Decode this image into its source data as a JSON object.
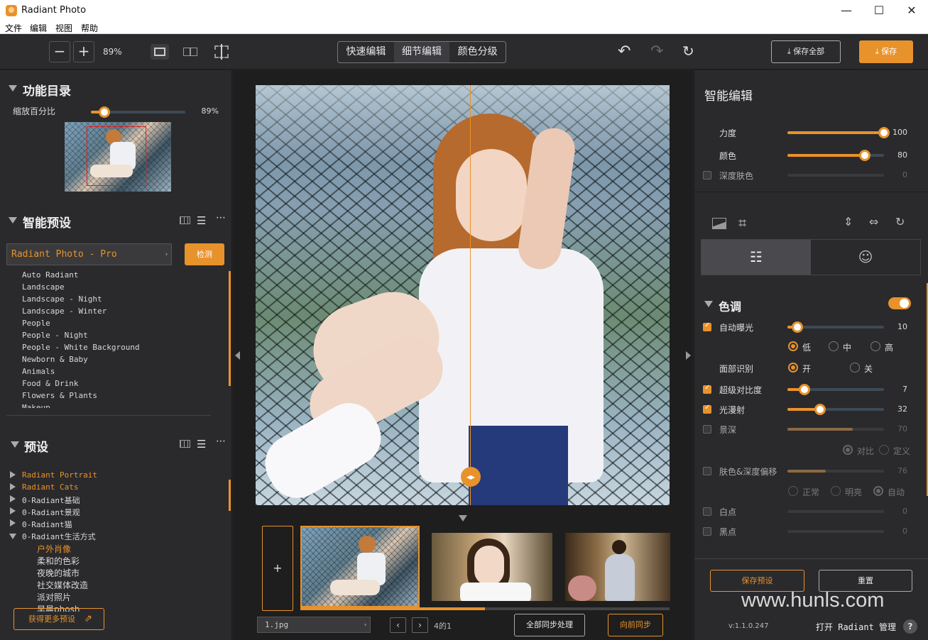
{
  "app": {
    "title": "Radiant Photo"
  },
  "window": {
    "minimize": "—",
    "maximize": "☐",
    "close": "✕"
  },
  "menu": [
    "文件",
    "编辑",
    "视图",
    "帮助"
  ],
  "toolbar": {
    "zoom_out": "−",
    "zoom_in": "+",
    "zoom_value": "89%",
    "modes": [
      "快速编辑",
      "细节编辑",
      "颜色分级"
    ],
    "save_all": "保存全部",
    "save": "保存"
  },
  "left": {
    "catalog_title": "功能目录",
    "zoom_label": "缩放百分比",
    "zoom_value": "89%",
    "zoom_fraction": 0.14,
    "smart_presets_title": "智能预设",
    "preset_selected": "Radiant Photo - Pro",
    "detect_label": "检测",
    "smart_presets": [
      "Auto Radiant",
      "Landscape",
      "Landscape - Night",
      "Landscape - Winter",
      "People",
      "People - Night",
      "People - White Background",
      "Newborn & Baby",
      "Animals",
      "Food & Drink",
      "Flowers & Plants",
      "Makeup"
    ],
    "presets_title": "预设",
    "preset_tree": [
      {
        "label": "Radiant Portrait",
        "orange": true,
        "level": 0,
        "open": false
      },
      {
        "label": "Radiant Cats",
        "orange": true,
        "level": 0,
        "open": false
      },
      {
        "label": "0-Radiant基础",
        "orange": false,
        "level": 0,
        "open": false
      },
      {
        "label": "0-Radiant景观",
        "orange": false,
        "level": 0,
        "open": false
      },
      {
        "label": "0-Radiant猫",
        "orange": false,
        "level": 0,
        "open": false
      },
      {
        "label": "0-Radiant生活方式",
        "orange": false,
        "level": 0,
        "open": true
      },
      {
        "label": "户外肖像",
        "orange": true,
        "level": 1
      },
      {
        "label": "柔和的色彩",
        "orange": false,
        "level": 1
      },
      {
        "label": "夜晚的城市",
        "orange": false,
        "level": 1
      },
      {
        "label": "社交媒体改造",
        "orange": false,
        "level": 1
      },
      {
        "label": "派对照片",
        "orange": false,
        "level": 1
      },
      {
        "label": "早晨phosh",
        "orange": false,
        "level": 1
      }
    ],
    "more_presets": "获得更多预设"
  },
  "center": {
    "add": "+",
    "filename": "1.jpg",
    "count": "4的1",
    "sync_all": "全部同步处理",
    "sync_forward": "向前同步"
  },
  "right": {
    "smart_edit_title": "智能编辑",
    "smart": [
      {
        "label": "力度",
        "value": "100",
        "fraction": 1.0,
        "enabled": true,
        "checkbox": false
      },
      {
        "label": "颜色",
        "value": "80",
        "fraction": 0.8,
        "enabled": true,
        "checkbox": false
      },
      {
        "label": "深度肤色",
        "value": "0",
        "fraction": 0.0,
        "enabled": false,
        "checkbox": true,
        "checked": false
      }
    ],
    "tone_title": "色调",
    "tone_toggle": true,
    "auto_exposure": {
      "label": "自动曝光",
      "value": "10",
      "fraction": 0.1,
      "checked": true
    },
    "exposure_levels": [
      "低",
      "中",
      "高"
    ],
    "exposure_selected": 0,
    "face_label": "面部识别",
    "face_options": [
      "开",
      "关"
    ],
    "face_selected": 0,
    "super_contrast": {
      "label": "超级对比度",
      "value": "7",
      "fraction": 0.18,
      "checked": true
    },
    "light_diffuse": {
      "label": "光漫射",
      "value": "32",
      "fraction": 0.34,
      "checked": true
    },
    "depth": {
      "label": "景深",
      "value": "70",
      "fraction": 0.68,
      "checked": false
    },
    "depth_modes": [
      "对比",
      "定义"
    ],
    "skin_depth": {
      "label": "肤色&深度偏移",
      "value": "76",
      "fraction": 0.4,
      "checked": false
    },
    "skin_modes": [
      "正常",
      "明亮",
      "自动"
    ],
    "whites": {
      "label": "白点",
      "value": "0",
      "fraction": 0.0,
      "checked": false
    },
    "blacks": {
      "label": "黑点",
      "value": "0",
      "fraction": 0.0,
      "checked": false
    },
    "save_preset": "保存预设",
    "reset": "重置",
    "version": "v:1.1.0.247",
    "open_manager": "打开 Radiant 管理",
    "help": "?"
  },
  "watermark": "www.hunls.com",
  "colors": {
    "accent": "#e8922c",
    "panel": "#2a2a2c",
    "bg": "#1e1e1e"
  }
}
